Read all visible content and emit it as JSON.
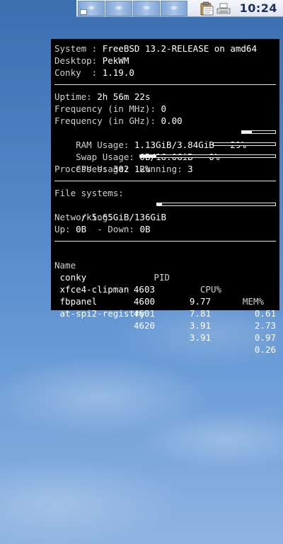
{
  "panel": {
    "workspaces": [
      "workspace-1",
      "workspace-2",
      "workspace-3",
      "workspace-4"
    ],
    "tray_icons": [
      "clipboard-icon",
      "printer-icon"
    ],
    "clock": "10:24"
  },
  "conky": {
    "system_label": "System : ",
    "system_value": "FreeBSD 13.2-RELEASE on amd64",
    "desktop_label": "Desktop: ",
    "desktop_value": "PekWM",
    "conky_label": "Conky  : ",
    "conky_value": "1.19.0",
    "uptime_label": "Uptime: ",
    "uptime_value": "2h 56m 22s",
    "freq_mhz_label": "Frequency (in MHz): ",
    "freq_mhz_value": "0",
    "freq_ghz_label": "Frequency (in GHz): ",
    "freq_ghz_value": "0.00",
    "ram_label": "RAM Usage: ",
    "ram_value": "1.13GiB/3.84GiB - 29%",
    "ram_percent": 29,
    "swap_label": "Swap Usage: ",
    "swap_value": "0B/16.0GiB - 0%",
    "swap_percent": 0,
    "cpu_label": "CPU Usage: ",
    "cpu_value": "12%",
    "cpu_percent": 12,
    "processes_label": "Processes: ",
    "processes_value": "302",
    "running_label": "  Running: ",
    "running_value": "3",
    "fs_label": "File systems:",
    "fs_value": " / 5.65GiB/136GiB",
    "fs_percent": 4,
    "net_label": "Networking:",
    "up_label": "Up: ",
    "up_value": "0B",
    "down_label": "  - Down: ",
    "down_value": "0B",
    "proc_headers": {
      "name": "Name",
      "pid": "PID",
      "cpu": "CPU%",
      "mem": "MEM%"
    },
    "processes": [
      {
        "name": " conky",
        "pid": "4603",
        "cpu": "9.77",
        "mem": "0.61"
      },
      {
        "name": " xfce4-clipman",
        "pid": "4600",
        "cpu": "7.81",
        "mem": "2.73"
      },
      {
        "name": " fbpanel",
        "pid": "4601",
        "cpu": "3.91",
        "mem": "0.97"
      },
      {
        "name": " at-spi2-registry",
        "pid": "4620",
        "cpu": "3.91",
        "mem": "0.26"
      }
    ]
  }
}
